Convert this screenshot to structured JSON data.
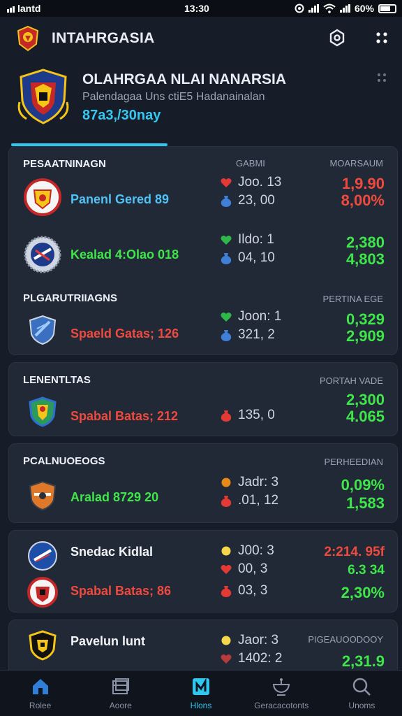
{
  "status_bar": {
    "carrier": "lantd",
    "time": "13:30",
    "battery": "60%"
  },
  "header": {
    "title": "INTAHRGASIA",
    "icons": [
      "crest-logo",
      "settings-gear-icon",
      "grid-dots-icon"
    ]
  },
  "hero": {
    "title": "OLAHRGAA NLAI NANARSIA",
    "subtitle": "Palendagaa Uns ctiE5 Hadanainalan",
    "date": "87a3,/30nay"
  },
  "colors": {
    "accent": "#2fc6ef",
    "positive": "#3ee64a",
    "negative": "#f04a3e",
    "card_bg": "#212836"
  },
  "sections": [
    {
      "title": "PESAATNINAGN",
      "col_stat": "GABMI",
      "col_value": "MOARSAUM",
      "rows": [
        {
          "team": "Panenl Gered 89",
          "team_color": "#4fc3f7",
          "stats": [
            {
              "icon": "heart-icon",
              "text": "Joo. 13"
            },
            {
              "icon": "bag-icon",
              "text": "23, 00"
            }
          ],
          "values": [
            "1,9.90",
            "8,00%"
          ],
          "value_color": "red"
        },
        {
          "team": "Kealad 4:Olao 018",
          "team_color": "#3ee64a",
          "stats": [
            {
              "icon": "green-shield-icon",
              "text": "Ildo: 1"
            },
            {
              "icon": "bag-icon",
              "text": "04, 10"
            }
          ],
          "values": [
            "2,380",
            "4,803"
          ],
          "value_color": "green"
        }
      ]
    },
    {
      "title": "PLGARUTRIIAGNS",
      "col_value": "PERTINA EGE",
      "rows": [
        {
          "team": "Spaeld Gatas; 126",
          "team_color": "#f04a3e",
          "stats": [
            {
              "icon": "green-shield-icon",
              "text": "Joon: 1"
            },
            {
              "icon": "bag-icon",
              "text": "321, 2"
            }
          ],
          "values": [
            "0,329",
            "2,909"
          ],
          "value_color": "green"
        }
      ]
    },
    {
      "title": "LENENTLTAS",
      "col_value": "PORTAH VADE",
      "rows": [
        {
          "team": "Spabal Batas; 212",
          "team_color": "#f04a3e",
          "stats": [
            {
              "icon": "red-bag-icon",
              "text": "135, 0"
            }
          ],
          "values": [
            "2,300",
            "4.065"
          ],
          "value_color": "green"
        }
      ]
    },
    {
      "title": "PCALNUOEOGS",
      "col_value": "PERHEEDIAN",
      "rows": [
        {
          "team": "Aralad 8729 20",
          "team_color": "#3ee64a",
          "stats": [
            {
              "icon": "orange-shield-icon",
              "text": "Jadr: 3"
            },
            {
              "icon": "red-bag-icon",
              "text": ".01, 12"
            }
          ],
          "values": [
            "0,09%",
            "1,583"
          ],
          "value_color": "green"
        }
      ]
    },
    {
      "rows": [
        {
          "team": "Snedac Kidlal",
          "team_color": "#f2f4f8",
          "stats": [
            {
              "icon": "yellow-dot-icon",
              "text": "J00: 3"
            },
            {
              "icon": "heart-icon",
              "text": "00, 3"
            }
          ],
          "values": [
            "2:214. 95f",
            "6.3 34"
          ],
          "value_colors": [
            "red",
            "green"
          ]
        },
        {
          "team": "Spabal Batas; 86",
          "team_color": "#f04a3e",
          "stats": [
            {
              "icon": "red-bag-icon",
              "text": "03, 3"
            }
          ],
          "values": [
            "2,30%"
          ],
          "value_color": "green"
        }
      ]
    },
    {
      "col_value": "PIGEAUOODOOY",
      "rows": [
        {
          "team": "Pavelun lunt",
          "team_color": "#f2f4f8",
          "stats": [
            {
              "icon": "yellow-dot-icon",
              "text": "Jaor: 3"
            },
            {
              "icon": "red-shield-icon",
              "text": "1402: 2"
            }
          ],
          "values": [
            "2,31.9"
          ],
          "value_color": "green"
        }
      ]
    }
  ],
  "bottom_nav": [
    {
      "label": "Rolee",
      "icon": "home-icon",
      "active": false
    },
    {
      "label": "Aoore",
      "icon": "calendar-icon",
      "active": false
    },
    {
      "label": "Hlons",
      "icon": "stats-icon",
      "active": true
    },
    {
      "label": "Geracacotonts",
      "icon": "trophy-icon",
      "active": false
    },
    {
      "label": "Unoms",
      "icon": "search-icon",
      "active": false
    }
  ]
}
